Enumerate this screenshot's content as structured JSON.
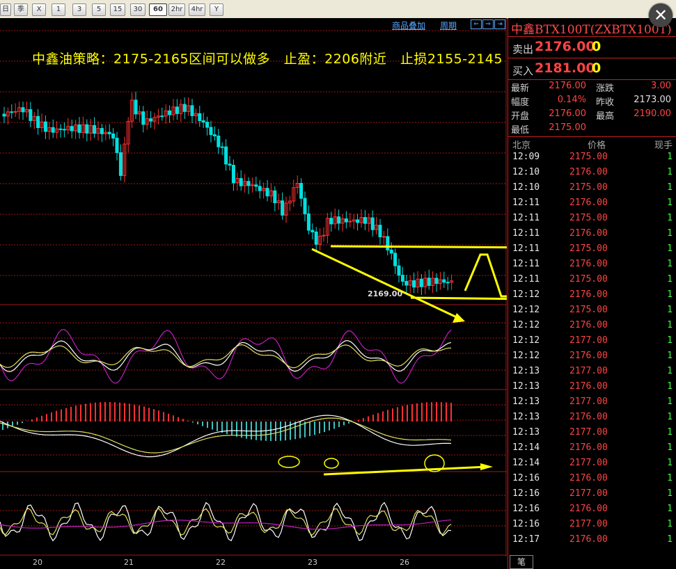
{
  "toolbar": {
    "buttons": [
      "日",
      "季",
      "X",
      "1",
      "3",
      "5",
      "15",
      "30",
      "60",
      "2hr",
      "4hr",
      "Y"
    ],
    "active": "60"
  },
  "chart": {
    "links": [
      "商品叠加",
      "周期"
    ],
    "strategy_text": "中鑫油策略：2175-2165区间可以做多　止盈：2206附近　止损2155-2145",
    "low_label": "2169.00",
    "date_labels": [
      "20",
      "21",
      "22",
      "23",
      "26"
    ]
  },
  "quote": {
    "title": "中鑫BTX100T(ZXBTX100T)",
    "sell_label": "卖出",
    "sell_price": "2176.00",
    "sell_vol": "0",
    "buy_label": "买入",
    "buy_price": "2181.00",
    "buy_vol": "0",
    "rows": [
      {
        "l1": "最新",
        "v1": "2176.00",
        "l2": "涨跌",
        "v2": "3.00"
      },
      {
        "l1": "幅度",
        "v1": "0.14%",
        "l2": "昨收",
        "v2": "2173.00"
      },
      {
        "l1": "开盘",
        "v1": "2176.00",
        "l2": "最高",
        "v2": "2190.00"
      },
      {
        "l1": "最低",
        "v1": "2175.00",
        "l2": "",
        "v2": ""
      }
    ],
    "tick_header": {
      "time": "北京",
      "price": "价格",
      "vol": "现手"
    },
    "ticks": [
      {
        "t": "12:09",
        "p": "2175.00",
        "v": "1"
      },
      {
        "t": "12:10",
        "p": "2176.00",
        "v": "1"
      },
      {
        "t": "12:10",
        "p": "2175.00",
        "v": "1"
      },
      {
        "t": "12:11",
        "p": "2176.00",
        "v": "1"
      },
      {
        "t": "12:11",
        "p": "2175.00",
        "v": "1"
      },
      {
        "t": "12:11",
        "p": "2176.00",
        "v": "1"
      },
      {
        "t": "12:11",
        "p": "2175.00",
        "v": "1"
      },
      {
        "t": "12:11",
        "p": "2176.00",
        "v": "1"
      },
      {
        "t": "12:11",
        "p": "2175.00",
        "v": "1"
      },
      {
        "t": "12:12",
        "p": "2176.00",
        "v": "1"
      },
      {
        "t": "12:12",
        "p": "2175.00",
        "v": "1"
      },
      {
        "t": "12:12",
        "p": "2176.00",
        "v": "1"
      },
      {
        "t": "12:12",
        "p": "2177.00",
        "v": "1"
      },
      {
        "t": "12:12",
        "p": "2176.00",
        "v": "1"
      },
      {
        "t": "12:13",
        "p": "2177.00",
        "v": "1"
      },
      {
        "t": "12:13",
        "p": "2176.00",
        "v": "1"
      },
      {
        "t": "12:13",
        "p": "2177.00",
        "v": "1"
      },
      {
        "t": "12:13",
        "p": "2176.00",
        "v": "1"
      },
      {
        "t": "12:13",
        "p": "2177.00",
        "v": "1"
      },
      {
        "t": "12:14",
        "p": "2176.00",
        "v": "1"
      },
      {
        "t": "12:14",
        "p": "2177.00",
        "v": "1"
      },
      {
        "t": "12:16",
        "p": "2176.00",
        "v": "1"
      },
      {
        "t": "12:16",
        "p": "2177.00",
        "v": "1"
      },
      {
        "t": "12:16",
        "p": "2176.00",
        "v": "1"
      },
      {
        "t": "12:16",
        "p": "2177.00",
        "v": "1"
      },
      {
        "t": "12:17",
        "p": "2176.00",
        "v": "1"
      }
    ],
    "bottom_tab": "笔"
  },
  "colors": {
    "up": "#ff3030",
    "down": "#00e0e0",
    "annot": "#ffff00",
    "grid": "#a01818"
  }
}
